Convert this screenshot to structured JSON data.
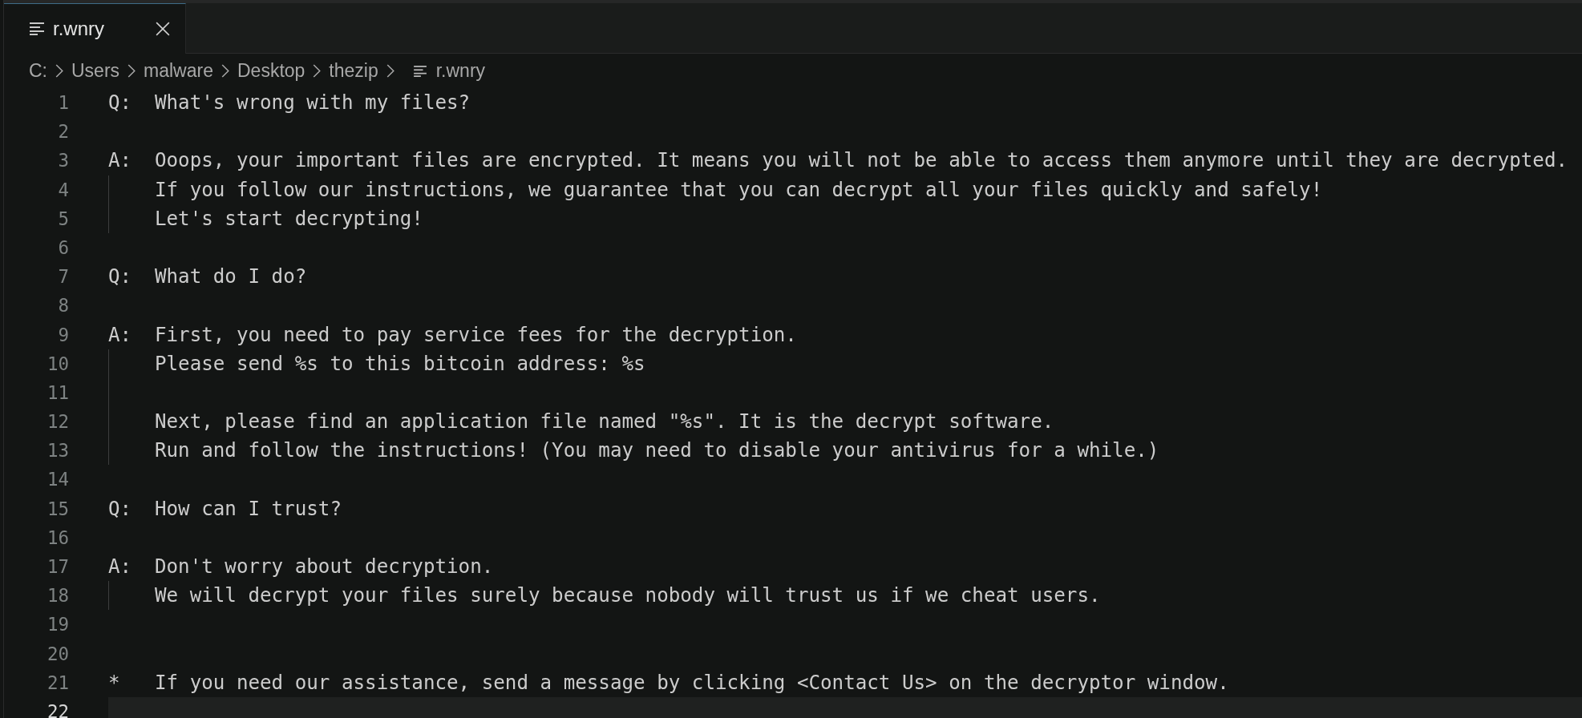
{
  "tabs": [
    {
      "label": "r.wnry",
      "selected": true
    }
  ],
  "breadcrumb": [
    {
      "label": "C:",
      "kind": "folder"
    },
    {
      "label": "Users",
      "kind": "folder"
    },
    {
      "label": "malware",
      "kind": "folder"
    },
    {
      "label": "Desktop",
      "kind": "folder"
    },
    {
      "label": "thezip",
      "kind": "folder"
    },
    {
      "label": "r.wnry",
      "kind": "file"
    }
  ],
  "editor": {
    "lines": [
      {
        "number": "1",
        "prefix": "Q:",
        "text": "What's wrong with my files?",
        "indent_guide": false,
        "current": false
      },
      {
        "number": "2",
        "indent_guide": false,
        "current": false
      },
      {
        "number": "3",
        "prefix": "A:",
        "text": "Ooops, your important files are encrypted. It means you will not be able to access them anymore until they are decrypted.",
        "indent_guide": false,
        "current": false
      },
      {
        "number": "4",
        "text": "If you follow our instructions, we guarantee that you can decrypt all your files quickly and safely!",
        "indent_guide": true,
        "current": false
      },
      {
        "number": "5",
        "text": "Let's start decrypting!",
        "indent_guide": true,
        "current": false
      },
      {
        "number": "6",
        "indent_guide": false,
        "current": false
      },
      {
        "number": "7",
        "prefix": "Q:",
        "text": "What do I do?",
        "indent_guide": false,
        "current": false
      },
      {
        "number": "8",
        "indent_guide": false,
        "current": false
      },
      {
        "number": "9",
        "prefix": "A:",
        "text": "First, you need to pay service fees for the decryption.",
        "indent_guide": false,
        "current": false
      },
      {
        "number": "10",
        "text": "Please send %s to this bitcoin address: %s",
        "indent_guide": true,
        "current": false
      },
      {
        "number": "11",
        "indent_guide": true,
        "current": false
      },
      {
        "number": "12",
        "text": "Next, please find an application file named \"%s\". It is the decrypt software.",
        "indent_guide": true,
        "current": false
      },
      {
        "number": "13",
        "text": "Run and follow the instructions! (You may need to disable your antivirus for a while.)",
        "indent_guide": true,
        "current": false
      },
      {
        "number": "14",
        "indent_guide": false,
        "current": false
      },
      {
        "number": "15",
        "prefix": "Q:",
        "text": "How can I trust?",
        "indent_guide": false,
        "current": false
      },
      {
        "number": "16",
        "indent_guide": false,
        "current": false
      },
      {
        "number": "17",
        "prefix": "A:",
        "text": "Don't worry about decryption.",
        "indent_guide": false,
        "current": false
      },
      {
        "number": "18",
        "text": "We will decrypt your files surely because nobody will trust us if we cheat users.",
        "indent_guide": true,
        "current": false
      },
      {
        "number": "19",
        "indent_guide": false,
        "current": false
      },
      {
        "number": "20",
        "indent_guide": false,
        "current": false
      },
      {
        "number": "21",
        "prefix": "*",
        "text": "If you need our assistance, send a message by clicking <Contact Us> on the decryptor window.",
        "indent_guide": false,
        "current": false
      },
      {
        "number": "22",
        "indent_guide": false,
        "current": true
      }
    ]
  }
}
